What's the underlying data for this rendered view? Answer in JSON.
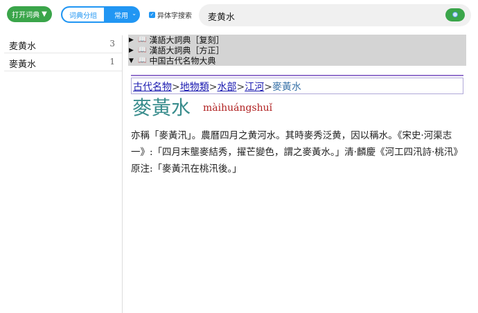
{
  "toolbar": {
    "open_dict_label": "打开词典",
    "open_dict_arrow": "▼",
    "group_label": "词典分组",
    "group_value": "常用",
    "variant_checkbox_label": "异体字搜索",
    "search_value": "麦黄水"
  },
  "sidebar": {
    "items": [
      {
        "label": "麦黄水",
        "count": "3"
      },
      {
        "label": "麥黃水",
        "count": "1"
      }
    ]
  },
  "dictionaries": [
    {
      "toggle": "▶",
      "name": "漢語大詞典［复刻］"
    },
    {
      "toggle": "▶",
      "name": "漢語大詞典［方正］"
    },
    {
      "toggle": "▼",
      "name": "中国古代名物大典"
    }
  ],
  "entry": {
    "breadcrumb": [
      "古代名物",
      "地物類",
      "水部",
      "江河"
    ],
    "breadcrumb_sep": ">",
    "current": "麥黃水",
    "headword": "麥黃水",
    "pinyin": "màihuángshuǐ",
    "definition": "亦稱「麥黃汛」。農曆四月之黄河水。其時麥秀泛黄，因以稱水。《宋史·河渠志一》:「四月末壟麥結秀，擢芒變色，謂之麥黃水。」清·麟慶《河工四汛詩·桃汛》原注:「麥黃汛在桃汛後。」"
  }
}
